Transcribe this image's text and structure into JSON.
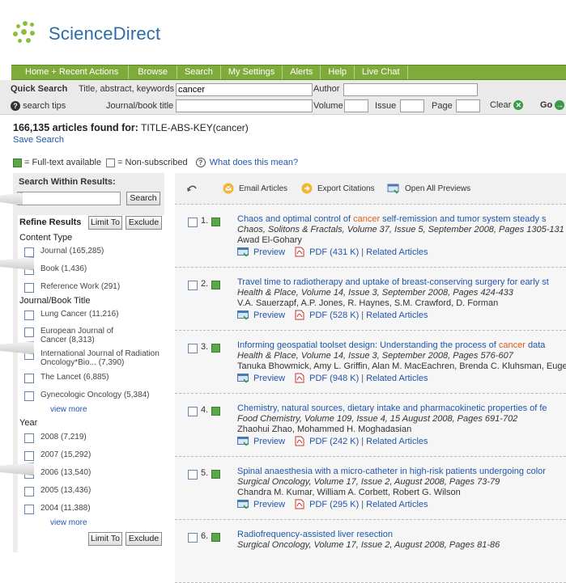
{
  "brand": "ScienceDirect",
  "nav": [
    "Home + Recent Actions",
    "Browse",
    "Search",
    "My Settings",
    "Alerts",
    "Help",
    "Live Chat"
  ],
  "quick_search": {
    "label": "Quick Search",
    "title_label": "Title, abstract, keywords",
    "title_value": "cancer",
    "author_label": "Author",
    "author_value": "",
    "tips": "search tips",
    "journal_label": "Journal/book title",
    "journal_value": "",
    "volume_label": "Volume",
    "issue_label": "Issue",
    "page_label": "Page",
    "clear": "Clear",
    "go": "Go"
  },
  "results_summary": {
    "count": "166,135 articles found for:",
    "query": " TITLE-ABS-KEY(cancer)",
    "save": "Save Search"
  },
  "legend": {
    "full": "= Full-text available",
    "non": "= Non-subscribed",
    "what": "What does this mean?"
  },
  "sidebar": {
    "search_within": "Search Within Results:",
    "search_btn": "Search",
    "refine": "Refine Results",
    "limit": "Limit To",
    "exclude": "Exclude",
    "content_type": "Content Type",
    "content_items": [
      "Journal (165,285)",
      "Book (1,436)",
      "Reference Work (291)"
    ],
    "journal_head": "Journal/Book Title",
    "journal_items": [
      "Lung Cancer (11,216)",
      "European Journal of",
      "Cancer (8,313)",
      "International Journal of Radiation",
      "Oncology*Bio... (7,390)",
      "The Lancet (6,885)",
      "Gynecologic Oncology (5,384)"
    ],
    "year_head": "Year",
    "year_items": [
      "2008 (7,219)",
      "2007 (15,292)",
      "2006 (13,540)",
      "2005 (13,436)",
      "2004 (11,388)"
    ],
    "view_more": "view more"
  },
  "toolbar": {
    "email": "Email Articles",
    "export": "Export Citations",
    "previews": "Open All Previews"
  },
  "results": [
    {
      "num": "1.",
      "title_pre": "Chaos and optimal control of ",
      "title_hl": "cancer",
      "title_post": " self-remission and tumor system steady s",
      "source": "Chaos, Solitons & Fractals, Volume 37, Issue 5, September 2008, Pages 1305-131",
      "authors": "Awad El-Gohary",
      "preview": "Preview",
      "pdf": "PDF (431 K)",
      "related": "Related Articles"
    },
    {
      "num": "2.",
      "title_pre": "Travel time to radiotherapy and uptake of breast-conserving surgery for early st",
      "title_hl": "",
      "title_post": "",
      "source": "Health & Place, Volume 14, Issue 3, September 2008, Pages 424-433",
      "authors": "V.A. Sauerzapf, A.P. Jones, R. Haynes, S.M. Crawford, D. Forman",
      "preview": "Preview",
      "pdf": "PDF (528 K)",
      "related": "Related Articles"
    },
    {
      "num": "3.",
      "title_pre": "Informing geospatial toolset design: Understanding the process of ",
      "title_hl": "cancer",
      "title_post": " data",
      "source": "Health & Place, Volume 14, Issue 3, September 2008, Pages 576-607",
      "authors": "Tanuka Bhowmick, Amy L. Griffin, Alan M. MacEachren, Brenda C. Kluhsman, Euge",
      "preview": "Preview",
      "pdf": "PDF (948 K)",
      "related": "Related Articles"
    },
    {
      "num": "4.",
      "title_pre": "Chemistry, natural sources, dietary intake and pharmacokinetic properties of fe",
      "title_hl": "",
      "title_post": "",
      "source": "Food Chemistry, Volume 109, Issue 4, 15 August 2008, Pages 691-702",
      "authors": "Zhaohui Zhao, Mohammed H. Moghadasian",
      "preview": "Preview",
      "pdf": "PDF (242 K)",
      "related": "Related Articles"
    },
    {
      "num": "5.",
      "title_pre": "Spinal anaesthesia with a micro-catheter in high-risk patients undergoing color",
      "title_hl": "",
      "title_post": "",
      "source": "Surgical Oncology, Volume 17, Issue 2, August 2008, Pages 73-79",
      "authors": "Chandra M. Kumar, William A. Corbett, Robert G. Wilson",
      "preview": "Preview",
      "pdf": "PDF (295 K)",
      "related": "Related Articles"
    },
    {
      "num": "6.",
      "title_pre": "Radiofrequency-assisted liver resection",
      "title_hl": "",
      "title_post": "",
      "source": "Surgical Oncology, Volume 17, Issue 2, August 2008, Pages 81-86",
      "authors": "",
      "preview": "",
      "pdf": "",
      "related": ""
    }
  ],
  "colors": {
    "nav_green": "#7fab3a",
    "link_blue": "#2255aa",
    "highlight_orange": "#e35a1a",
    "brand_blue": "#2b6ca8"
  }
}
